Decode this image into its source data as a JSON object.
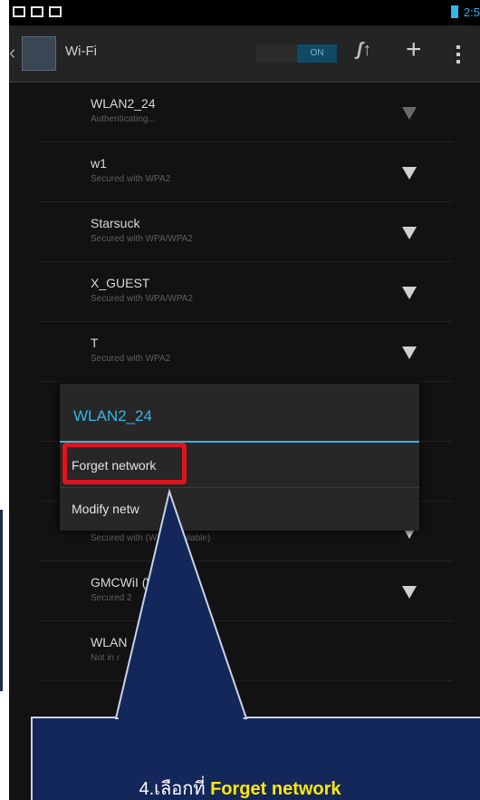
{
  "status_bar": {
    "time": "2:5"
  },
  "action_bar": {
    "title": "Wi-Fi",
    "toggle_label": "ON",
    "icons": [
      "back-chevron",
      "wifi-settings-app-icon",
      "wps-icon",
      "add-network-icon",
      "overflow-menu-icon"
    ]
  },
  "networks": [
    {
      "ssid": "WLAN2_24",
      "status": "Authenticating..."
    },
    {
      "ssid": "w1",
      "status": "Secured with WPA2"
    },
    {
      "ssid": "Starsuck",
      "status": "Secured with WPA/WPA2"
    },
    {
      "ssid": "X_GUEST",
      "status": "Secured with WPA/WPA2"
    },
    {
      "ssid": "T",
      "status": "Secured with WPA2"
    },
    {
      "ssid": "",
      "status": ""
    },
    {
      "ssid": "",
      "status": ""
    },
    {
      "ssid": "",
      "status": "Secured with      (WPS available)"
    },
    {
      "ssid": "GMCWiI           (WAN_7C",
      "status": "Secured                2"
    },
    {
      "ssid": "WLAN",
      "status": "Not in r"
    }
  ],
  "dialog": {
    "title": "WLAN2_24",
    "items": [
      "Forget network",
      "Modify netw"
    ]
  },
  "callout": {
    "prefix": "4.เลือกที่ ",
    "highlight": "Forget network"
  },
  "colors": {
    "accent": "#33b5e5",
    "highlight_box": "#e0141e",
    "callout_bg": "#14275a",
    "callout_highlight": "#ffe800"
  }
}
